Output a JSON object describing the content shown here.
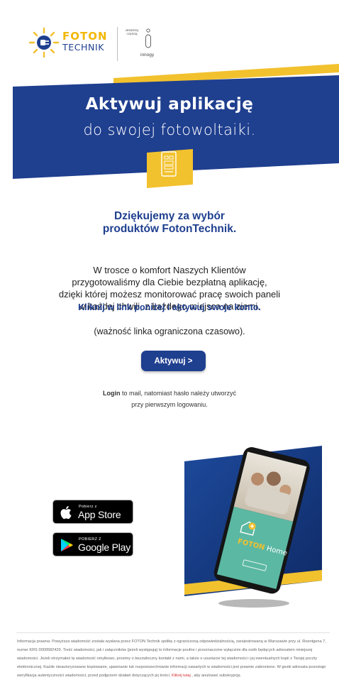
{
  "brand": {
    "foton": "FOTON",
    "technik": "TECHNIK",
    "partner_label_line1": "Jesteśmy",
    "partner_label_line2": "częścią",
    "partner_name": "innogy",
    "colors": {
      "blue": "#1f3f8f",
      "yellow": "#f2c12e",
      "accent_red": "#d32f2f"
    }
  },
  "banner": {
    "title": "Aktywuj aplikację",
    "subtitle": "do swojej fotowoltaiki.",
    "icon": "phone-icon"
  },
  "thanks": {
    "line1": "Dziękujemy za wybór",
    "line2": "produktów FotonTechnik."
  },
  "intro": {
    "line1": "W trosce o komfort Naszych Klientów",
    "line2": "przygotowaliśmy dla Ciebie bezpłatną aplikację,",
    "line3": "dzięki której możesz monitorować pracę swoich paneli",
    "line4": "w każdej chwili, z każdego miejsca na ziemi."
  },
  "cta_text": "Kliknij w link poniżej i aktywuj swoje konto.",
  "validity": "(ważność linka ograniczona czasowo).",
  "activate_button": "Aktywuj >",
  "login_note": {
    "bold": "Login",
    "rest_line1": " to mail, natomiast hasło należy utworzyć",
    "line2": "przy pierwszym logowaniu."
  },
  "phone_app": {
    "app_name_a": "FOTON",
    "app_name_b": " Home"
  },
  "badges": {
    "appstore_small": "Pobierz z",
    "appstore_big": "App Store",
    "googleplay_small": "POBIERZ Z",
    "googleplay_big": "Google Play"
  },
  "footer": {
    "text": "Informacja prawna: Powyższa wiadomość została wysłana przez FOTON Technik spółkę z ograniczoną odpowiedzialnością, zarejestrowaną w Warszawie przy ul. Roentgena 7, numer KRS 0000582429. Treść wiadomości, jak i załączników (jeżeli występują) to informacje poufne i przeznaczone wyłącznie dla osób będących adresatem niniejszej wiadomości. Jeżeli otrzymałeś tę wiadomość omyłkowo, prosimy o bezzwłoczny kontakt z nami, a także o usunięcie tej wiadomości i jej ewentualnych kopii z Twojej poczty elektronicznej. Każde nieautoryzowane kopiowanie, ujawnianie lub rozpowszechnianie informacji zawartych w wiadomości jest prawnie zabronione. W gestii adresata pozostaje weryfikacja autentyczności wiadomości, przed podjęciem działań dotyczących jej treści.",
    "link": "Kliknij tutaj",
    "after_link": " , aby anulować subskrypcję."
  }
}
